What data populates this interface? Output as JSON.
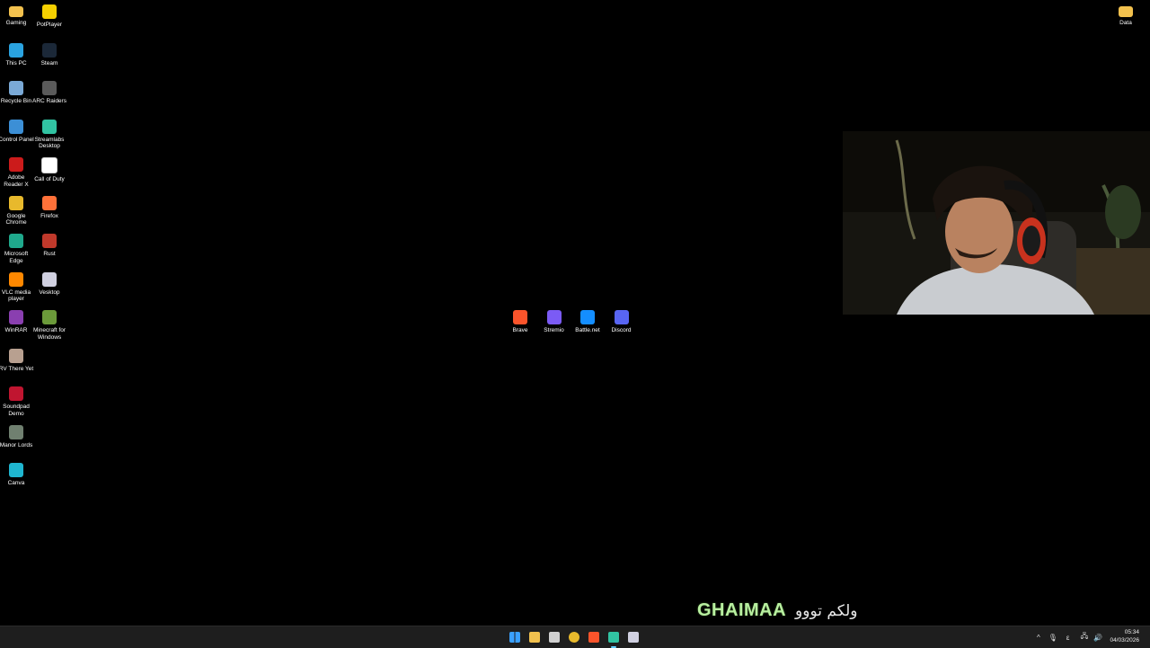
{
  "desktop": {
    "left_icons": [
      {
        "label": "Gaming",
        "icon": "folder-icon",
        "color": "#f2c14e"
      },
      {
        "label": "PotPlayer",
        "icon": "potplayer-icon",
        "color": "#f5d000"
      },
      {
        "label": "This PC",
        "icon": "monitor-icon",
        "color": "#2aa3e0"
      },
      {
        "label": "Steam",
        "icon": "steam-icon",
        "color": "#1b2838"
      },
      {
        "label": "Recycle Bin",
        "icon": "recycle-bin-icon",
        "color": "#7aa9d6"
      },
      {
        "label": "ARC Raiders",
        "icon": "arc-raiders-icon",
        "color": "#5a5a5a"
      },
      {
        "label": "Control Panel",
        "icon": "control-panel-icon",
        "color": "#3c8fd6"
      },
      {
        "label": "Streamlabs Desktop",
        "icon": "streamlabs-icon",
        "color": "#31c3a2"
      },
      {
        "label": "Adobe Reader X",
        "icon": "adobe-reader-icon",
        "color": "#cc1b1b"
      },
      {
        "label": "Call of Duty",
        "icon": "document-icon",
        "color": "#ffffff"
      },
      {
        "label": "Google Chrome",
        "icon": "chrome-icon",
        "color": "#e8b92c"
      },
      {
        "label": "Firefox",
        "icon": "firefox-icon",
        "color": "#ff7139"
      },
      {
        "label": "Microsoft Edge",
        "icon": "edge-icon",
        "color": "#1fa98c"
      },
      {
        "label": "Rust",
        "icon": "rust-icon",
        "color": "#c0392b"
      },
      {
        "label": "VLC media player",
        "icon": "vlc-icon",
        "color": "#ff8800"
      },
      {
        "label": "Vesktop",
        "icon": "vesktop-icon",
        "color": "#d0d0e0"
      },
      {
        "label": "WinRAR",
        "icon": "winrar-icon",
        "color": "#8a3fb0"
      },
      {
        "label": "Minecraft for Windows",
        "icon": "minecraft-icon",
        "color": "#6b9a3a"
      },
      {
        "label": "RV There Yet",
        "icon": "rv-there-yet-icon",
        "color": "#b8a090"
      },
      {
        "label": "Soundpad Demo",
        "icon": "soundpad-icon",
        "color": "#c01530"
      },
      {
        "label": "Manor Lords",
        "icon": "manor-lords-icon",
        "color": "#708070"
      },
      {
        "label": "Canva",
        "icon": "canva-icon",
        "color": "#1fb6d0"
      }
    ],
    "center_icons": [
      {
        "label": "Brave",
        "icon": "brave-icon",
        "color": "#fb542b"
      },
      {
        "label": "Stremio",
        "icon": "stremio-icon",
        "color": "#7b5bf5"
      },
      {
        "label": "Battle.net",
        "icon": "battlenet-icon",
        "color": "#148eff"
      },
      {
        "label": "Discord",
        "icon": "discord-icon",
        "color": "#5865f2"
      }
    ],
    "right_icons": [
      {
        "label": "Data",
        "icon": "folder-icon",
        "color": "#f2c14e"
      }
    ]
  },
  "overlay": {
    "welcome_name": "GHAIMAA",
    "welcome_text": "ولکم تووو"
  },
  "taskbar": {
    "apps": [
      {
        "name": "start-button",
        "icon": "windows-icon",
        "color": "#3aa0ff"
      },
      {
        "name": "file-explorer",
        "icon": "folder-icon",
        "color": "#f2c14e"
      },
      {
        "name": "calendar-app",
        "icon": "calendar-icon",
        "color": "#d0d0d0"
      },
      {
        "name": "chrome",
        "icon": "chrome-icon",
        "color": "#e8b92c"
      },
      {
        "name": "brave",
        "icon": "brave-icon",
        "color": "#fb542b"
      },
      {
        "name": "streamlabs",
        "icon": "streamlabs-icon",
        "color": "#31c3a2"
      },
      {
        "name": "vesktop",
        "icon": "vesktop-icon",
        "color": "#d0d0e0"
      }
    ],
    "tray": {
      "lang": "ε",
      "time": "05:34",
      "date": "04/03/2026"
    }
  }
}
